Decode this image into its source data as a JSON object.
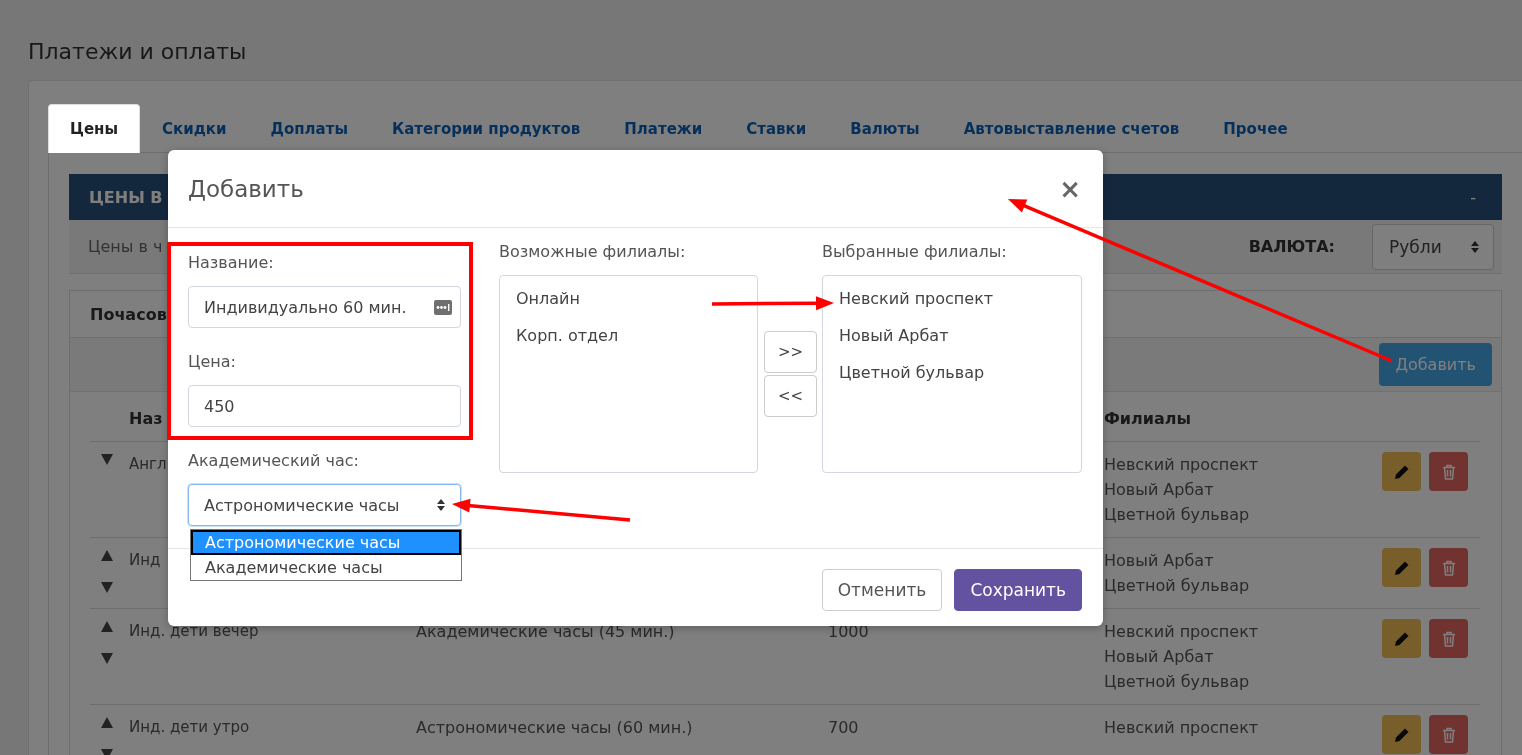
{
  "page": {
    "title": "Платежи и оплаты"
  },
  "tabs": [
    {
      "label": "Цены",
      "selected": true
    },
    {
      "label": "Скидки",
      "selected": false
    },
    {
      "label": "Доплаты",
      "selected": false
    },
    {
      "label": "Категории продуктов",
      "selected": false
    },
    {
      "label": "Платежи",
      "selected": false
    },
    {
      "label": "Ставки",
      "selected": false
    },
    {
      "label": "Валюты",
      "selected": false
    },
    {
      "label": "Автовыставление счетов",
      "selected": false
    },
    {
      "label": "Прочее",
      "selected": false
    }
  ],
  "panel": {
    "title": "ЦЕНЫ В",
    "collapse": "-",
    "description": "Цены в ч",
    "currency_label": "ВАЛЮТА:",
    "currency": "Рубли"
  },
  "prices_card": {
    "title": "Почасов",
    "add_button": "Добавить"
  },
  "table": {
    "header": {
      "name": "Наз",
      "branches": "Филиалы"
    },
    "rows": [
      {
        "name": "Англ",
        "move_up": false,
        "move_down": true,
        "branches": [
          "Невский проспект",
          "Новый Арбат",
          "Цветной бульвар"
        ]
      },
      {
        "name": "Инд",
        "move_up": true,
        "move_down": true,
        "branches": [
          "Новый Арбат",
          "Цветной бульвар"
        ]
      },
      {
        "name": "Инд. дети вечер",
        "hour_type": "Академические часы (45 мин.)",
        "price": "1000",
        "move_up": true,
        "move_down": true,
        "branches": [
          "Невский проспект",
          "Новый Арбат",
          "Цветной бульвар"
        ]
      },
      {
        "name": "Инд. дети утро",
        "hour_type": "Астрономические часы (60 мин.)",
        "price": "700",
        "move_up": true,
        "move_down": true,
        "branches": [
          "Невский проспект"
        ]
      }
    ]
  },
  "dialog": {
    "title": "Добавить",
    "close": "×",
    "fields": [
      {
        "kind": "input",
        "label": "Название:",
        "value": "Индивидуально 60 мин.",
        "autofill_icon": true
      },
      {
        "kind": "input",
        "label": "Цена:",
        "value": "450",
        "autofill_icon": false
      },
      {
        "kind": "select",
        "label": "Академический час:",
        "value": "Астрономические часы",
        "focused": true,
        "open": true,
        "options": [
          {
            "label": "Астрономические часы",
            "selected": true
          },
          {
            "label": "Академические часы",
            "selected": false
          }
        ]
      }
    ],
    "available": {
      "label": "Возможные филиалы:",
      "items": [
        "Онлайн",
        "Корп. отдел"
      ]
    },
    "add_selected": ">>",
    "remove_selected": "<<",
    "chosen": {
      "label": "Выбранные филиалы:",
      "items": [
        "Невский проспект",
        "Новый Арбат",
        "Цветной бульвар"
      ]
    },
    "buttons": [
      {
        "kind": "default",
        "label": "Отменить"
      },
      {
        "kind": "primary",
        "label": "Сохранить"
      }
    ]
  },
  "annotations": [
    {
      "kind": "frame"
    },
    {
      "kind": "arrow"
    },
    {
      "kind": "arrow"
    },
    {
      "kind": "arrow"
    }
  ]
}
